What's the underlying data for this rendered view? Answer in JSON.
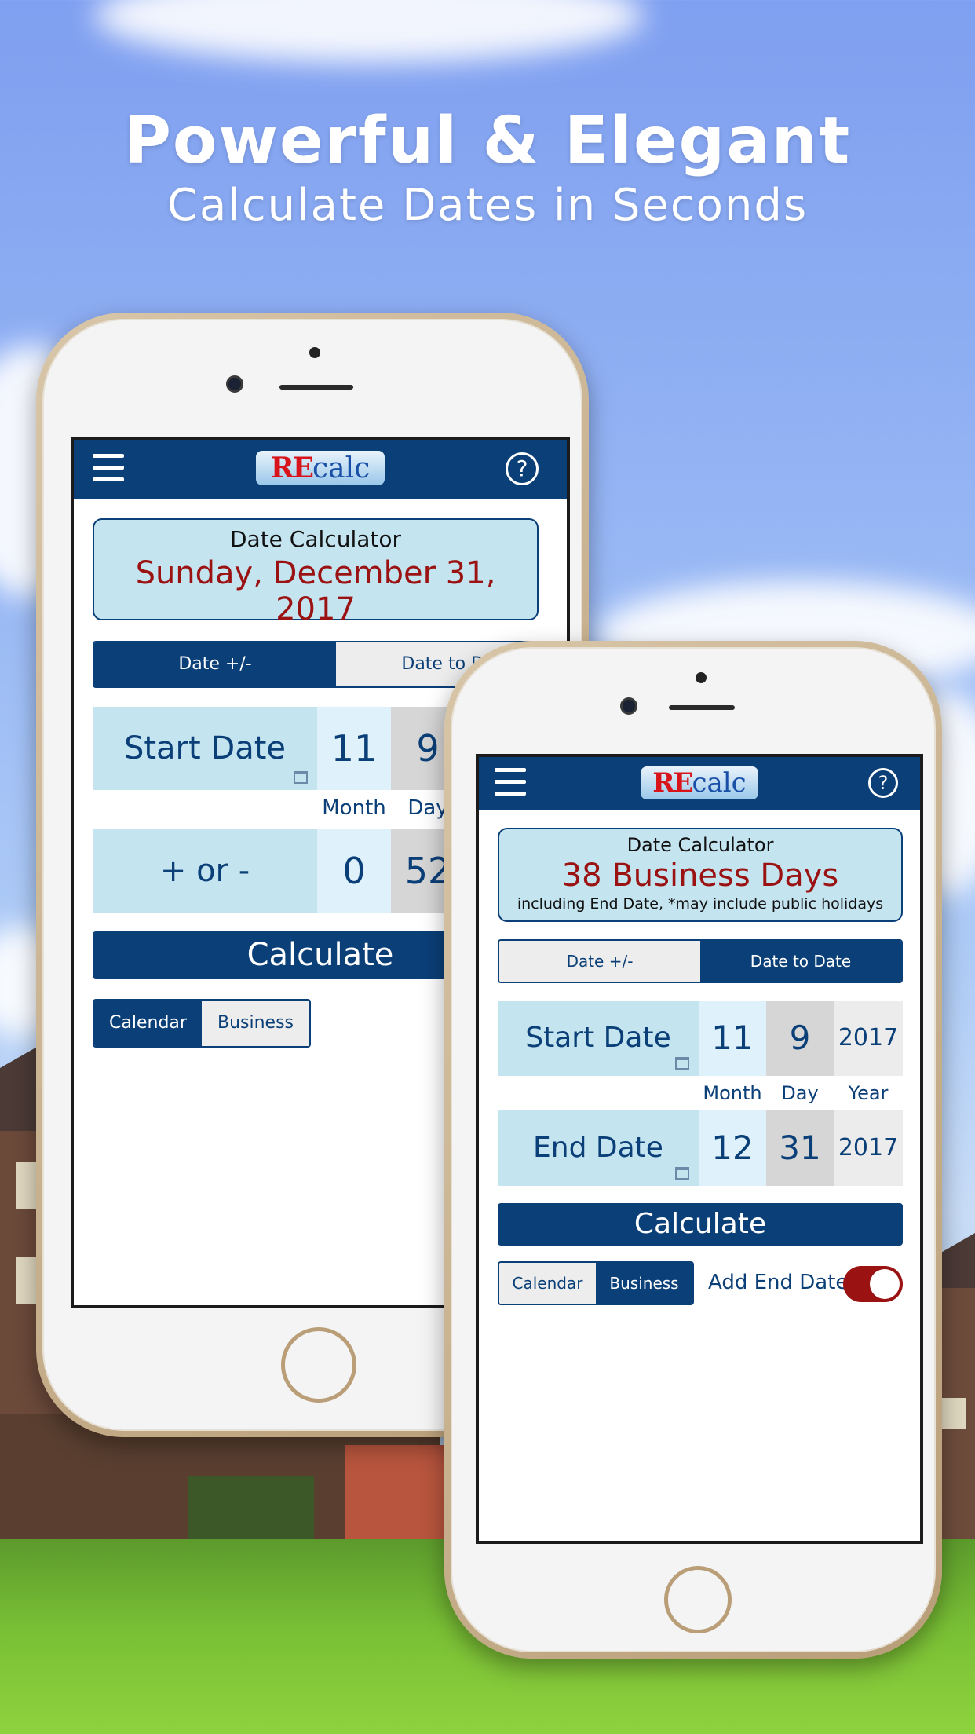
{
  "headline": {
    "title": "Powerful & Elegant",
    "subtitle": "Calculate Dates in Seconds"
  },
  "logo": {
    "re": "RE",
    "calc": "calc"
  },
  "icons": {
    "menu": "hamburger-icon",
    "help": "help-icon",
    "help_glyph": "?",
    "calendar": "calendar-icon"
  },
  "phone1": {
    "result_title": "Date Calculator",
    "result_value": "Sunday, December 31, 2017",
    "tabs": [
      "Date +/-",
      "Date to Date"
    ],
    "active_tab": 0,
    "start_label": "Start Date",
    "start_month": "11",
    "start_day": "9",
    "col_month": "Month",
    "col_day": "Day",
    "plusminus_label": "+ or -",
    "pm_value1": "0",
    "pm_value2": "52",
    "calculate": "Calculate",
    "mode": [
      "Calendar",
      "Business"
    ],
    "active_mode": 0
  },
  "phone2": {
    "result_title": "Date Calculator",
    "result_value": "38 Business Days",
    "result_note": "including End Date, *may include public holidays",
    "tabs": [
      "Date +/-",
      "Date to Date"
    ],
    "active_tab": 1,
    "start_label": "Start Date",
    "start_month": "11",
    "start_day": "9",
    "start_year": "2017",
    "col_month": "Month",
    "col_day": "Day",
    "col_year": "Year",
    "end_label": "End Date",
    "end_month": "12",
    "end_day": "31",
    "end_year": "2017",
    "calculate": "Calculate",
    "mode": [
      "Calendar",
      "Business"
    ],
    "active_mode": 1,
    "add_end_label": "Add End Date?",
    "add_end_on": true
  },
  "colors": {
    "navy": "#0b3f78",
    "light_blue": "#c4e4f0",
    "dark_red": "#9b1212"
  }
}
